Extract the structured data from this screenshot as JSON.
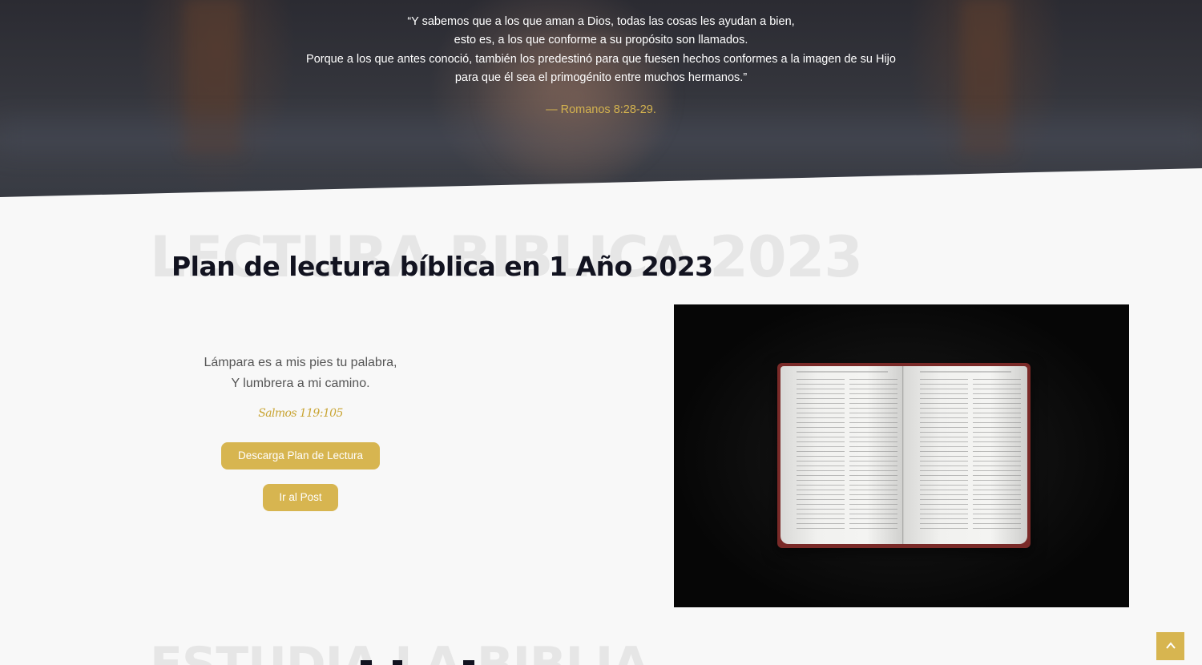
{
  "hero": {
    "quote_lines": [
      "“Y sabemos que a los que aman a Dios, todas las cosas les ayudan a bien,",
      "esto es, a los que conforme a su propósito son llamados.",
      "Porque a los que antes conoció, también los predestinó para que fuesen hechos conformes a la imagen de su Hijo",
      "para que él sea el primogénito entre muchos hermanos.”"
    ],
    "reference": "— Romanos 8:28-29."
  },
  "reading_plan": {
    "background_title": "LECTURA BIBLICA 2023",
    "title": "Plan de lectura bíblica en 1 Año 2023",
    "verse_lines": [
      "Lámpara es a mis pies tu palabra,",
      "Y lumbrera a mi camino."
    ],
    "verse_reference": "Salmos 119:105",
    "download_button": "Descarga Plan de Lectura",
    "post_button": "Ir al Post",
    "image_icon": "open-bible-photo"
  },
  "next_section": {
    "background_title": "ESTUDIA LA BIBLIA"
  },
  "scroll_top_icon": "chevron-up-icon",
  "colors": {
    "accent": "#d7b550",
    "heading": "#121320",
    "background": "#f8f8f8"
  }
}
